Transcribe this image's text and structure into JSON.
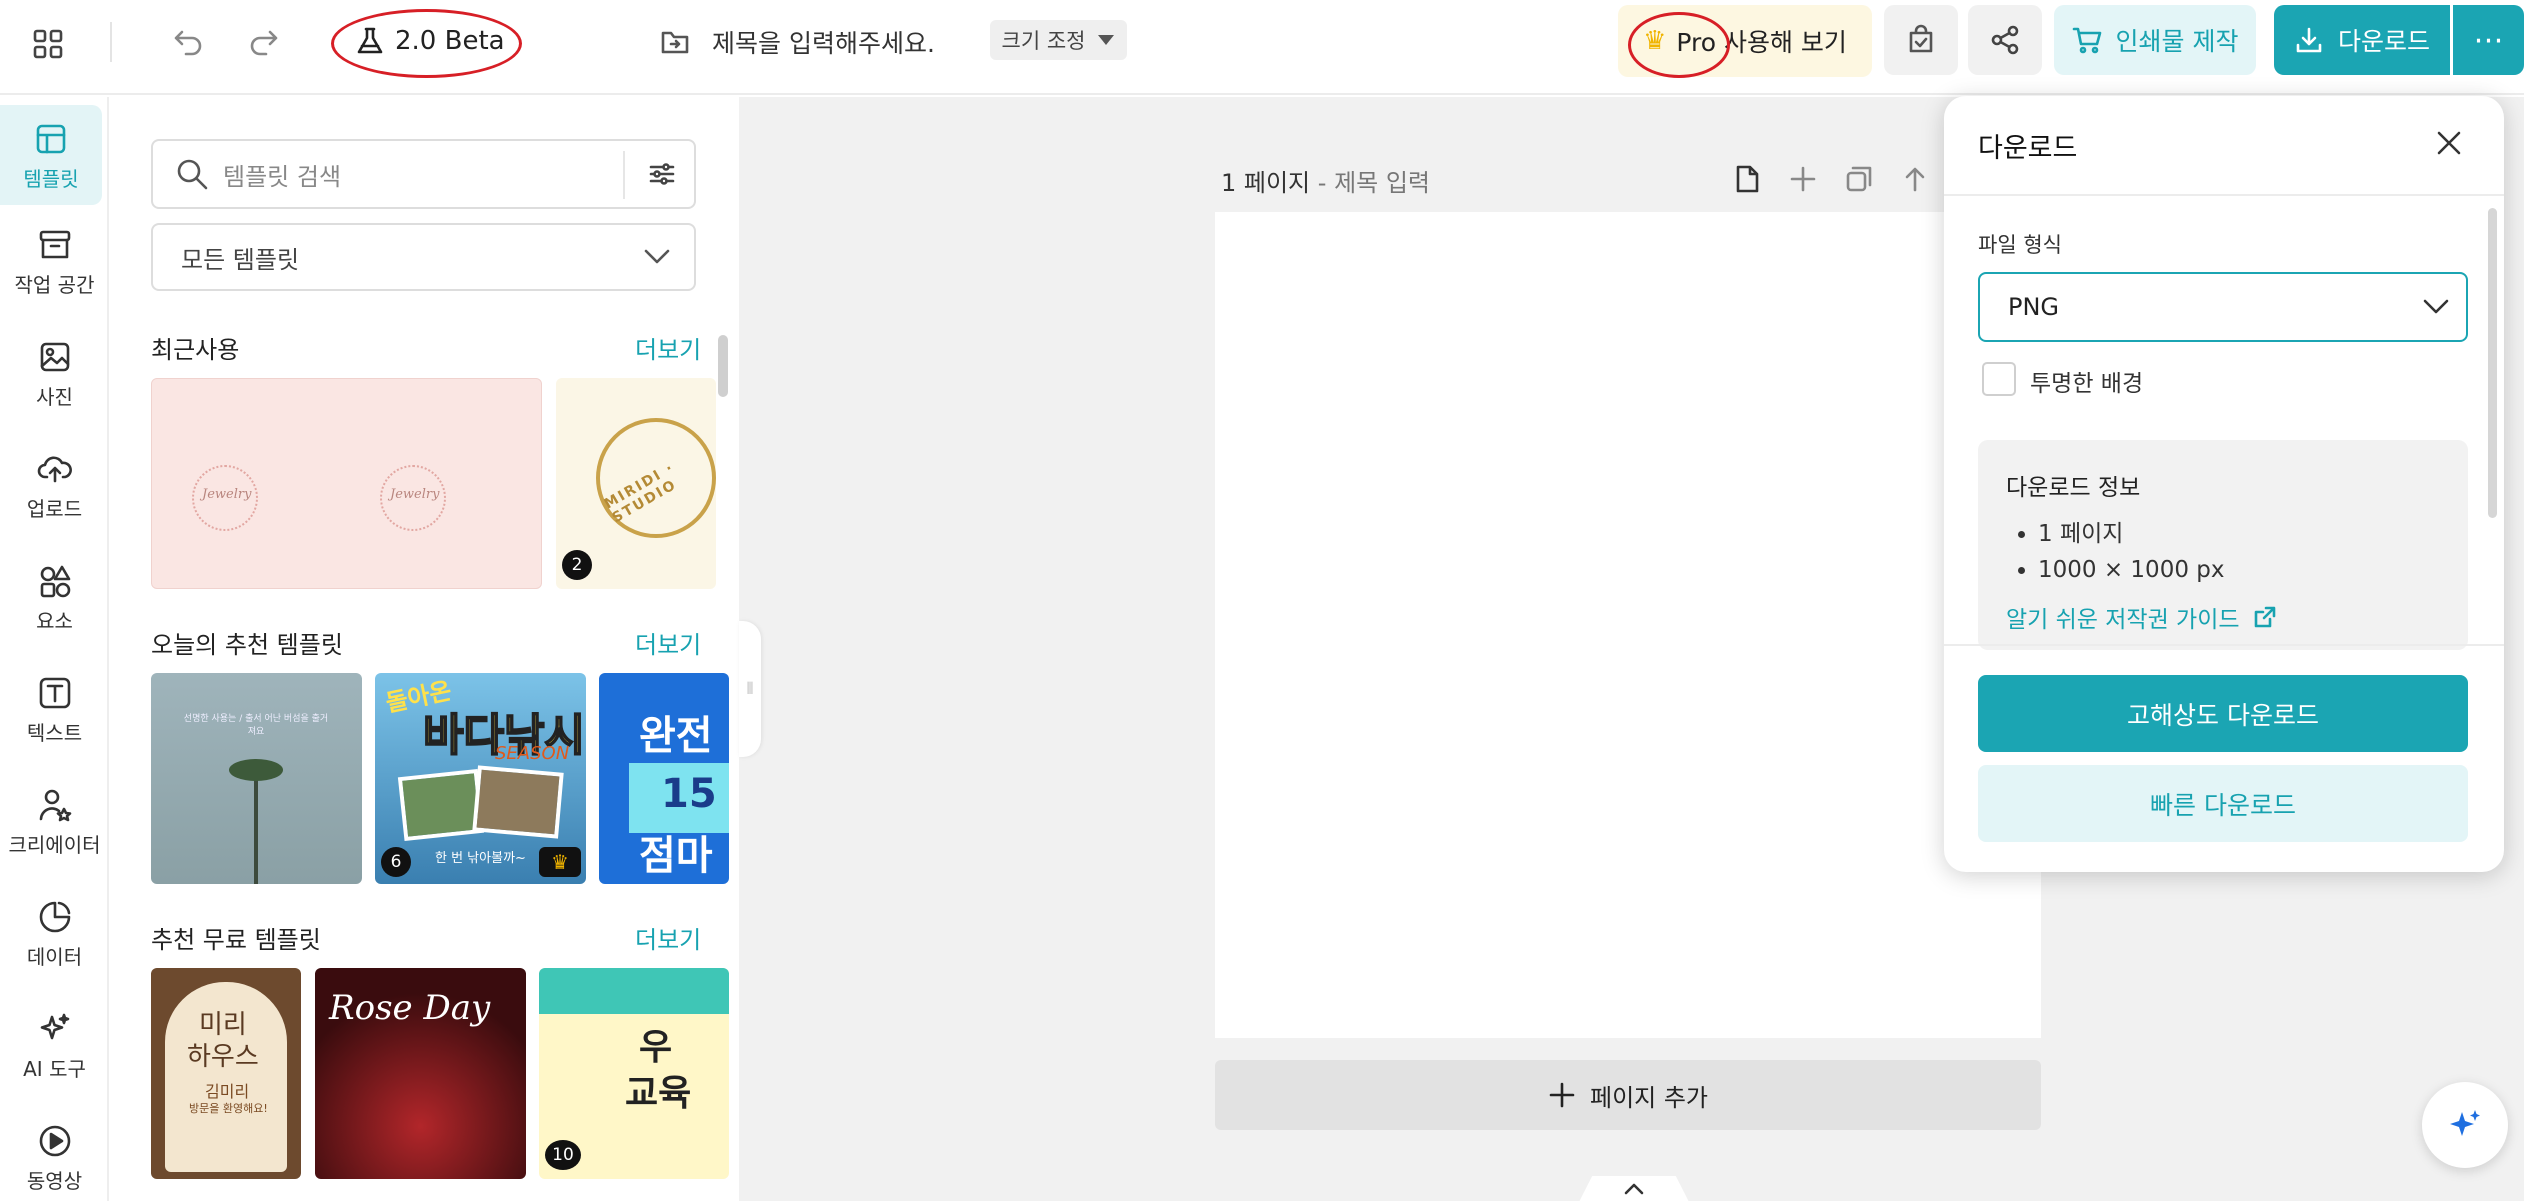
{
  "topbar": {
    "beta_label": "2.0 Beta",
    "title_placeholder": "제목을 입력해주세요.",
    "resize_label": "크기 조정",
    "pro_label": "Pro 사용해 보기",
    "print_label": "인쇄물 제작",
    "download_label": "다운로드",
    "more_label": "⋯"
  },
  "sidebar": {
    "items": [
      {
        "label": "템플릿",
        "icon": "template-icon"
      },
      {
        "label": "작업 공간",
        "icon": "archive-icon"
      },
      {
        "label": "사진",
        "icon": "photo-icon"
      },
      {
        "label": "업로드",
        "icon": "cloud-upload-icon"
      },
      {
        "label": "요소",
        "icon": "elements-icon"
      },
      {
        "label": "텍스트",
        "icon": "text-icon"
      },
      {
        "label": "크리에이터",
        "icon": "creator-icon"
      },
      {
        "label": "데이터",
        "icon": "chart-icon"
      },
      {
        "label": "AI 도구",
        "icon": "sparkle-icon"
      },
      {
        "label": "동영상",
        "icon": "play-icon"
      }
    ]
  },
  "panel": {
    "search_placeholder": "템플릿 검색",
    "filter_value": "모든 템플릿",
    "sections": [
      {
        "title": "최근사용",
        "more": "더보기"
      },
      {
        "title": "오늘의 추천 템플릿",
        "more": "더보기"
      },
      {
        "title": "추천 무료 템플릿",
        "more": "더보기"
      }
    ],
    "recent": [
      {
        "text_left": "Jewelry",
        "text_right": "Jewelry"
      },
      {
        "text": "MIRIDI · STUDIO",
        "badge": "2"
      }
    ],
    "today": [
      {
        "caption": "선명한 사용는 / 출서 어난 버섬을 출거져요"
      },
      {
        "headline_top": "돌아온",
        "headline": "바다낚시",
        "season": "SEASON",
        "footer": "한 번 낚아볼까~",
        "badge": "6",
        "crown": "♛"
      },
      {
        "headline": "완전",
        "sub": "15",
        "tail": "점마"
      }
    ],
    "free": [
      {
        "title_line1": "미리",
        "title_line2": "하우스",
        "name": "김미리",
        "sub": "방문을 환영해요!"
      },
      {
        "title": "Rose Day"
      },
      {
        "title_line1": "우",
        "title_line2": "교육",
        "badge": "10"
      }
    ]
  },
  "canvas": {
    "page_number": "1 페이지",
    "page_sep": " - ",
    "page_title": "제목 입력",
    "add_page_label": "페이지 추가"
  },
  "download_panel": {
    "title": "다운로드",
    "format_label": "파일 형식",
    "format_value": "PNG",
    "transparent_label": "투명한 배경",
    "info_title": "다운로드 정보",
    "info_items": [
      "1 페이지",
      "1000 × 1000 px"
    ],
    "copyright_link": "알기 쉬운 저작권 가이드",
    "hq_button": "고해상도 다운로드",
    "fast_button": "빠른 다운로드"
  },
  "colors": {
    "accent": "#1ba5b3",
    "accent_light": "#e3f5f7",
    "pro_bg": "#fdf7e1",
    "annotation_red": "#d71f26"
  }
}
